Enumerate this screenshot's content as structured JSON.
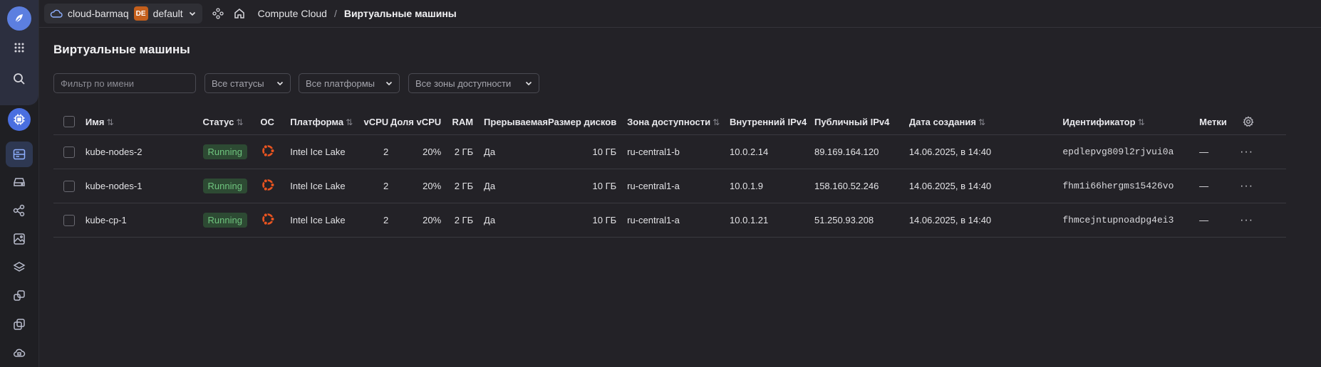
{
  "topbar": {
    "cloud_name": "cloud-barmaq",
    "folder_badge": "DE",
    "folder_name": "default",
    "crumb_service": "Compute Cloud",
    "crumb_separator": "/",
    "crumb_current": "Виртуальные машины"
  },
  "page": {
    "title": "Виртуальные машины",
    "filter_placeholder": "Фильтр по имени",
    "status_select": "Все статусы",
    "platform_select": "Все платформы",
    "zone_select": "Все зоны доступности"
  },
  "table": {
    "headers": {
      "name": "Имя",
      "status": "Статус",
      "os": "ОС",
      "platform": "Платформа",
      "vcpu": "vCPU",
      "share": "Доля vCPU",
      "ram": "RAM",
      "preemptible": "Прерываемая",
      "disk": "Размер дисков",
      "zone": "Зона доступности",
      "ipv4_int": "Внутренний IPv4",
      "ipv4_pub": "Публичный IPv4",
      "created": "Дата создания",
      "id": "Идентификатор",
      "labels": "Метки"
    },
    "sort_icon": "⇅",
    "rows": [
      {
        "name": "kube-nodes-2",
        "status": "Running",
        "os_icon": "ubuntu-icon",
        "platform": "Intel Ice Lake",
        "vcpu": "2",
        "share": "20%",
        "ram": "2 ГБ",
        "preemptible": "Да",
        "disk": "10 ГБ",
        "zone": "ru-central1-b",
        "ipv4_int": "10.0.2.14",
        "ipv4_pub": "89.169.164.120",
        "created": "14.06.2025, в 14:40",
        "id": "epdlepvg809l2rjvui0a",
        "labels": "—",
        "more": "···"
      },
      {
        "name": "kube-nodes-1",
        "status": "Running",
        "os_icon": "ubuntu-icon",
        "platform": "Intel Ice Lake",
        "vcpu": "2",
        "share": "20%",
        "ram": "2 ГБ",
        "preemptible": "Да",
        "disk": "10 ГБ",
        "zone": "ru-central1-a",
        "ipv4_int": "10.0.1.9",
        "ipv4_pub": "158.160.52.246",
        "created": "14.06.2025, в 14:40",
        "id": "fhm1i66hergms15426vo",
        "labels": "—",
        "more": "···"
      },
      {
        "name": "kube-cp-1",
        "status": "Running",
        "os_icon": "ubuntu-icon",
        "platform": "Intel Ice Lake",
        "vcpu": "2",
        "share": "20%",
        "ram": "2 ГБ",
        "preemptible": "Да",
        "disk": "10 ГБ",
        "zone": "ru-central1-a",
        "ipv4_int": "10.0.1.21",
        "ipv4_pub": "51.250.93.208",
        "created": "14.06.2025, в 14:40",
        "id": "fhmcejntupnoadpg4ei3",
        "labels": "—",
        "more": "···"
      }
    ]
  },
  "colors": {
    "background": "#232227",
    "status_running_bg": "#2d4a33",
    "status_running_text": "#6fc47e",
    "ubuntu": "#e95420",
    "accent": "#4a6fe0"
  }
}
